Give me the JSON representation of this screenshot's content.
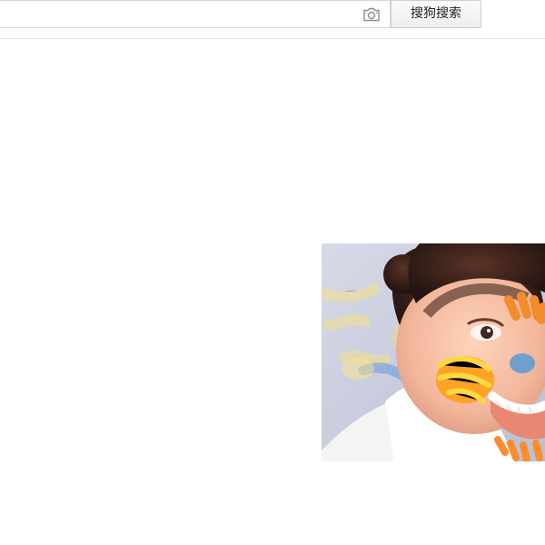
{
  "search": {
    "query": "",
    "placeholder": "",
    "button_label": "搜狗搜索",
    "camera_icon": "camera-icon"
  },
  "result": {
    "image_alt": "",
    "image_icon": "child-face-paint-image"
  },
  "colors": {
    "border": "#d8d8d8",
    "button_bg": "#f3f3f3",
    "text": "#222222",
    "thumb_bg": "#d9dbe7"
  }
}
